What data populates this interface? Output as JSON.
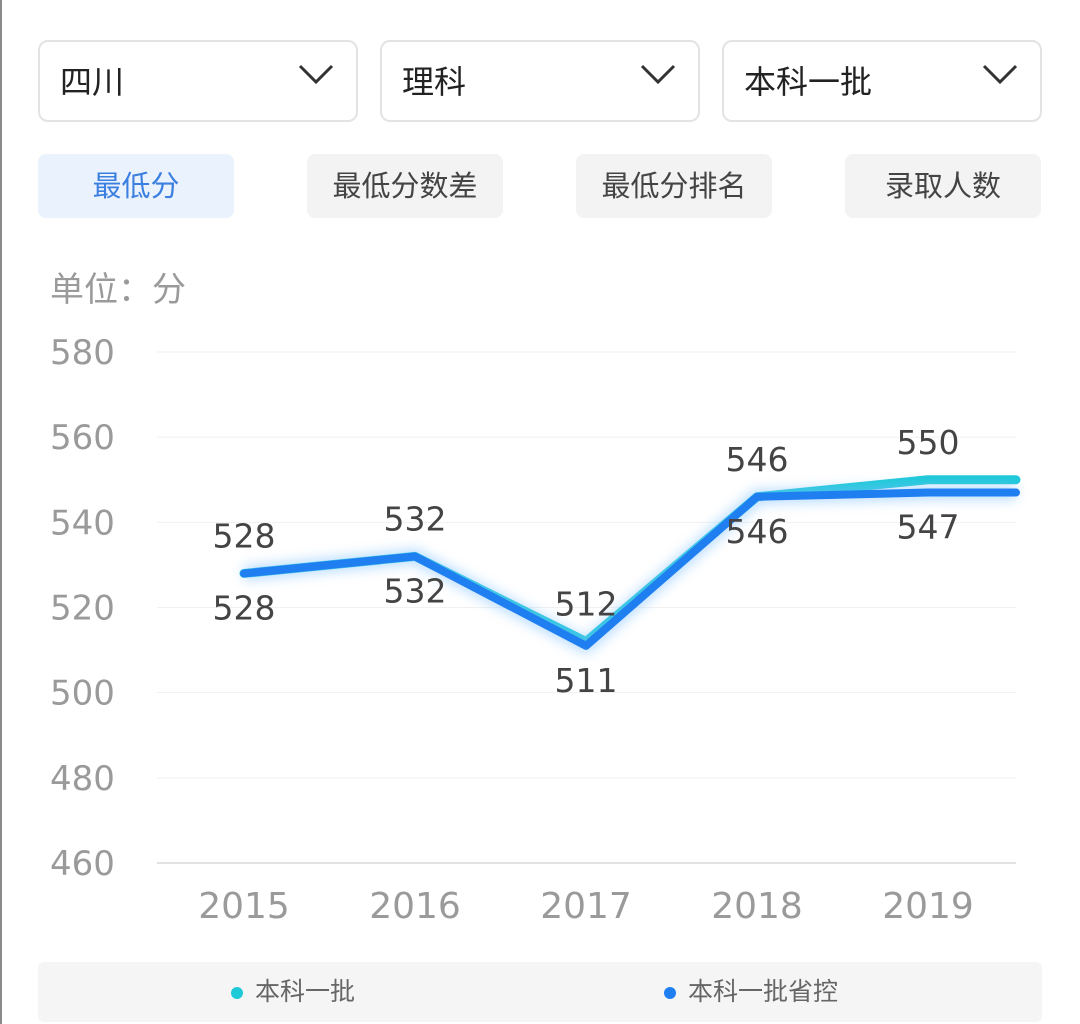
{
  "filters": {
    "province": "四川",
    "subject": "理科",
    "batch": "本科一批"
  },
  "tabs": [
    "最低分",
    "最低分数差",
    "最低分排名",
    "录取人数"
  ],
  "unit_label": "单位：分",
  "colors": {
    "series_1": "#1ec9d8",
    "series_2": "#1f7ff0",
    "active_tab_bg": "#eaf2fe",
    "active_tab_text": "#3b7fe0"
  },
  "chart_data": {
    "type": "line",
    "x": [
      "2015",
      "2016",
      "2017",
      "2018",
      "2019"
    ],
    "ylim": [
      460,
      580
    ],
    "yticks": [
      "580",
      "560",
      "540",
      "520",
      "500",
      "480",
      "460"
    ],
    "grid": true,
    "legend_position": "bottom",
    "series": [
      {
        "name": "本科一批",
        "values": [
          528,
          532,
          512,
          546,
          550
        ],
        "color": "#1ec9d8",
        "labels": [
          "528",
          "532",
          "512",
          "546",
          "550"
        ]
      },
      {
        "name": "本科一批省控",
        "values": [
          528,
          532,
          511,
          546,
          547
        ],
        "color": "#1f7ff0",
        "labels": [
          "528",
          "532",
          "511",
          "546",
          "547"
        ]
      }
    ]
  }
}
